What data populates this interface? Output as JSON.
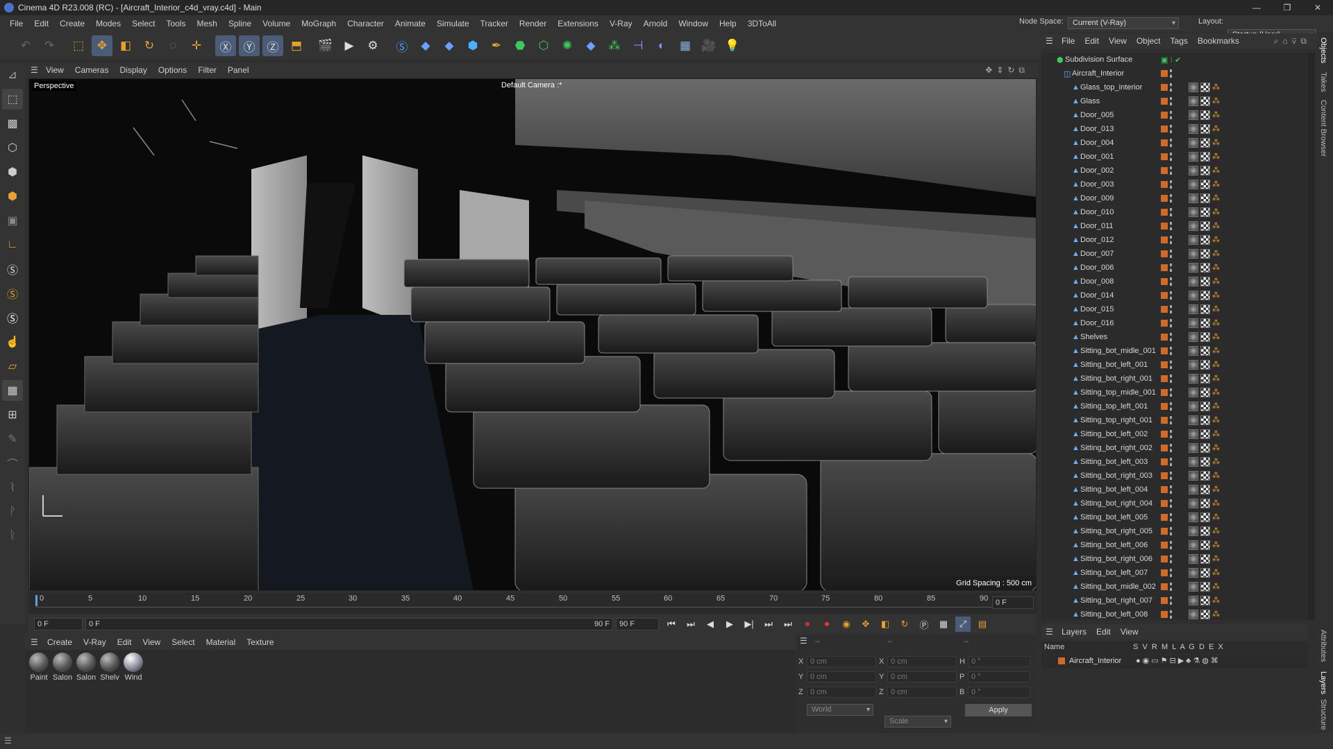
{
  "window": {
    "title": "Cinema 4D R23.008 (RC) - [Aircraft_Interior_c4d_vray.c4d] - Main"
  },
  "menubar": [
    "File",
    "Edit",
    "Create",
    "Modes",
    "Select",
    "Tools",
    "Mesh",
    "Spline",
    "Volume",
    "MoGraph",
    "Character",
    "Animate",
    "Simulate",
    "Tracker",
    "Render",
    "Extensions",
    "V-Ray",
    "Arnold",
    "Window",
    "Help",
    "3DToAll"
  ],
  "nodespace": {
    "label": "Node Space:",
    "value": "Current (V-Ray)"
  },
  "layout": {
    "label": "Layout:",
    "value": "Startup (User)"
  },
  "viewport": {
    "menu": [
      "View",
      "Cameras",
      "Display",
      "Options",
      "Filter",
      "Panel"
    ],
    "label": "Perspective",
    "camera": "Default Camera :*",
    "grid_spacing": "Grid Spacing : 500 cm"
  },
  "timeline": {
    "ticks": [
      "0",
      "5",
      "10",
      "15",
      "20",
      "25",
      "30",
      "35",
      "40",
      "45",
      "50",
      "55",
      "60",
      "65",
      "70",
      "75",
      "80",
      "85",
      "90"
    ],
    "end_frame_field": "0 F"
  },
  "transport": {
    "start": "0 F",
    "current": "0 F",
    "end": "90 F",
    "end2": "90 F"
  },
  "materials": {
    "menu": [
      "Create",
      "V-Ray",
      "Edit",
      "View",
      "Select",
      "Material",
      "Texture"
    ],
    "items": [
      "Paint",
      "Salon",
      "Salon",
      "Shelv",
      "Wind"
    ]
  },
  "attributes": {
    "rows": [
      {
        "a": "X",
        "av": "0 cm",
        "b": "X",
        "bv": "0 cm",
        "c": "H",
        "cv": "0 °"
      },
      {
        "a": "Y",
        "av": "0 cm",
        "b": "Y",
        "bv": "0 cm",
        "c": "P",
        "cv": "0 °"
      },
      {
        "a": "Z",
        "av": "0 cm",
        "b": "Z",
        "bv": "0 cm",
        "c": "B",
        "cv": "0 °"
      }
    ],
    "header": [
      "--",
      "--",
      "--"
    ],
    "coord_mode": "World",
    "size_mode": "Scale",
    "apply": "Apply"
  },
  "objects": {
    "menu": [
      "File",
      "Edit",
      "View",
      "Object",
      "Tags",
      "Bookmarks"
    ],
    "root": "Subdivision Surface",
    "group": "Aircraft_Interior",
    "items": [
      "Glass_top_interior",
      "Glass",
      "Door_005",
      "Door_013",
      "Door_004",
      "Door_001",
      "Door_002",
      "Door_003",
      "Door_009",
      "Door_010",
      "Door_011",
      "Door_012",
      "Door_007",
      "Door_006",
      "Door_008",
      "Door_014",
      "Door_015",
      "Door_016",
      "Shelves",
      "Sitting_bot_midle_001",
      "Sitting_bot_left_001",
      "Sitting_bot_right_001",
      "Sitting_top_midle_001",
      "Sitting_top_left_001",
      "Sitting_top_right_001",
      "Sitting_bot_left_002",
      "Sitting_bot_right_002",
      "Sitting_bot_left_003",
      "Sitting_bot_right_003",
      "Sitting_bot_left_004",
      "Sitting_bot_right_004",
      "Sitting_bot_left_005",
      "Sitting_bot_right_005",
      "Sitting_bot_left_006",
      "Sitting_bot_right_006",
      "Sitting_bot_left_007",
      "Sitting_bot_midle_002",
      "Sitting_bot_right_007",
      "Sitting_bot_left_008"
    ]
  },
  "layers": {
    "menu": [
      "Layers",
      "Edit",
      "View"
    ],
    "columns": {
      "name": "Name",
      "flags": "S  V  R  M  L  A  G  D  E  X"
    },
    "row": "Aircraft_Interior"
  },
  "right_tabs": [
    "Objects",
    "Takes",
    "Content Browser",
    "Attributes",
    "Layers",
    "Structure"
  ],
  "colors": {
    "accent": "#4a5c78",
    "layer_color": "#d06a2a"
  }
}
